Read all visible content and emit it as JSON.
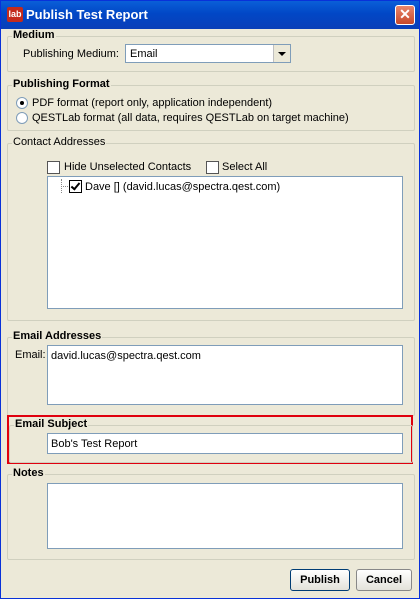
{
  "window": {
    "title": "Publish Test Report",
    "app_icon_text": "lab",
    "close_glyph": "✕"
  },
  "medium": {
    "group_title": "Medium",
    "label": "Publishing Medium:",
    "selected": "Email"
  },
  "format": {
    "group_title": "Publishing Format",
    "options": [
      {
        "label": "PDF format (report only, application independent)",
        "selected": true
      },
      {
        "label": "QESTLab format (all data, requires QESTLab on target machine)",
        "selected": false
      }
    ]
  },
  "contacts": {
    "group_title": "Contact Addresses",
    "hide_unselected_label": "Hide Unselected Contacts",
    "hide_unselected_checked": false,
    "select_all_label": "Select All",
    "select_all_checked": false,
    "items": [
      {
        "label": "Dave [] (david.lucas@spectra.qest.com)",
        "checked": true
      }
    ]
  },
  "email_addresses": {
    "group_title": "Email Addresses",
    "label": "Email:",
    "value": "david.lucas@spectra.qest.com"
  },
  "email_subject": {
    "group_title": "Email Subject",
    "value": "Bob's Test Report"
  },
  "notes": {
    "group_title": "Notes",
    "value": ""
  },
  "buttons": {
    "publish": "Publish",
    "cancel": "Cancel"
  },
  "colors": {
    "titlebar": "#0147c6",
    "highlight_frame": "#e0000e",
    "dialog_bg": "#ece9d8"
  }
}
